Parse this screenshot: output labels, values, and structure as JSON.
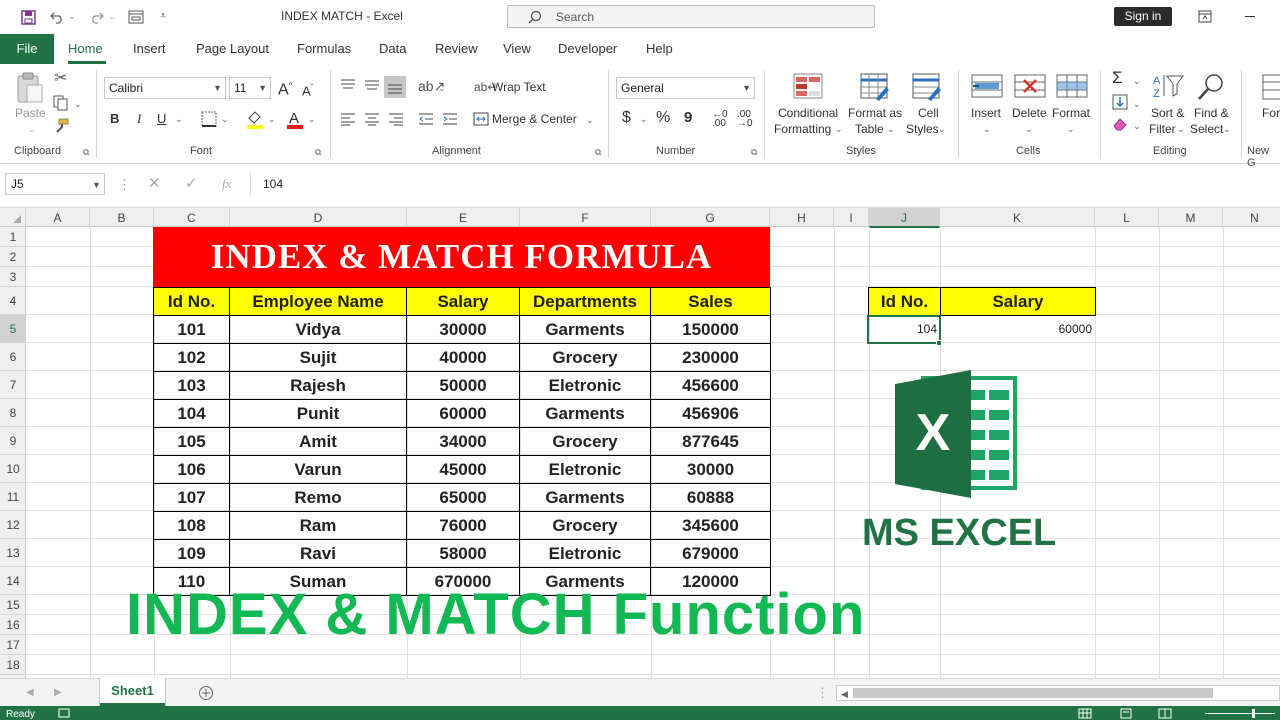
{
  "titlebar": {
    "doc_title": "INDEX MATCH  -  Excel",
    "search_placeholder": "Search",
    "signin": "Sign in"
  },
  "tabs": [
    "File",
    "Home",
    "Insert",
    "Page Layout",
    "Formulas",
    "Data",
    "Review",
    "View",
    "Developer",
    "Help"
  ],
  "active_tab": "Home",
  "ribbon": {
    "clipboard": {
      "paste": "Paste",
      "group": "Clipboard"
    },
    "font": {
      "name": "Calibri",
      "size": "11",
      "group": "Font",
      "bold": "B",
      "italic": "I",
      "underline": "U"
    },
    "alignment": {
      "wrap": "Wrap Text",
      "merge": "Merge & Center",
      "group": "Alignment"
    },
    "number": {
      "format": "General",
      "group": "Number",
      "currency": "$",
      "percent": "%",
      "comma": "9"
    },
    "styles": {
      "cond1": "Conditional",
      "cond2": "Formatting",
      "fmt1": "Format as",
      "fmt2": "Table",
      "cell1": "Cell",
      "cell2": "Styles",
      "group": "Styles"
    },
    "cells": {
      "insert": "Insert",
      "delete": "Delete",
      "format": "Format",
      "group": "Cells"
    },
    "editing": {
      "sort1": "Sort &",
      "sort2": "Filter",
      "find1": "Find &",
      "find2": "Select",
      "group": "Editing",
      "sigma": "Σ"
    },
    "newgroup": {
      "label": "New G",
      "btn": "For"
    }
  },
  "formula_bar": {
    "name_box": "J5",
    "value": "104",
    "fx": "fx"
  },
  "columns": [
    "A",
    "B",
    "C",
    "D",
    "E",
    "F",
    "G",
    "H",
    "I",
    "J",
    "K",
    "L",
    "M",
    "N"
  ],
  "rows": [
    "1",
    "2",
    "3",
    "4",
    "5",
    "6",
    "7",
    "8",
    "9",
    "10",
    "11",
    "12",
    "13",
    "14",
    "15",
    "16",
    "17",
    "18"
  ],
  "sheet": {
    "title": "INDEX & MATCH  FORMULA",
    "headers": [
      "Id No.",
      "Employee Name",
      "Salary",
      "Departments",
      "Sales"
    ],
    "data": [
      [
        "101",
        "Vidya",
        "30000",
        "Garments",
        "150000"
      ],
      [
        "102",
        "Sujit",
        "40000",
        "Grocery",
        "230000"
      ],
      [
        "103",
        "Rajesh",
        "50000",
        "Eletronic",
        "456600"
      ],
      [
        "104",
        "Punit",
        "60000",
        "Garments",
        "456906"
      ],
      [
        "105",
        "Amit",
        "34000",
        "Grocery",
        "877645"
      ],
      [
        "106",
        "Varun",
        "45000",
        "Eletronic",
        "30000"
      ],
      [
        "107",
        "Remo",
        "65000",
        "Garments",
        "60888"
      ],
      [
        "108",
        "Ram",
        "76000",
        "Grocery",
        "345600"
      ],
      [
        "109",
        "Ravi",
        "58000",
        "Eletronic",
        "679000"
      ],
      [
        "110",
        "Suman",
        "670000",
        "Garments",
        "120000"
      ]
    ],
    "lookup": {
      "headers": [
        "Id No.",
        "Salary"
      ],
      "id": "104",
      "salary": "60000"
    },
    "overlay_text": "INDEX & MATCH  Function",
    "logo_text": "MS EXCEL",
    "logo_letter": "X"
  },
  "sheet_tab": "Sheet1",
  "status": "Ready",
  "colors": {
    "excel_green": "#217346",
    "header_yellow": "#ffff00",
    "title_red": "#ff0000",
    "overlay_green": "#12b854"
  }
}
